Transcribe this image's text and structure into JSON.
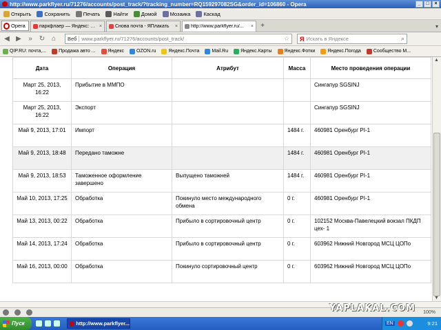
{
  "window": {
    "title": "http://www.parkflyer.ru/71276/accounts/post_track/?tracking_number=RQ159297082SG&order_id=106860 - Opera",
    "buttons": [
      "_",
      "□",
      "×"
    ]
  },
  "toolbar": {
    "items": [
      {
        "label": "Открыть",
        "icon": "folder-icon",
        "color": "#d9a630"
      },
      {
        "label": "Сохранить",
        "icon": "save-icon",
        "color": "#3a6fc4"
      },
      {
        "label": "Печать",
        "icon": "print-icon",
        "color": "#777777"
      },
      {
        "label": "Найти",
        "icon": "find-icon",
        "color": "#5a5a5a"
      },
      {
        "label": "Домой",
        "icon": "home-icon",
        "color": "#4b8b3b"
      },
      {
        "label": "Мозаика",
        "icon": "tile-icon",
        "color": "#6f6f9c"
      },
      {
        "label": "Каскад",
        "icon": "cascade-icon",
        "color": "#6f6f9c"
      }
    ]
  },
  "tabs": {
    "opera_label": "Opera",
    "items": [
      {
        "label": "паркфлаер — Яндекс: наш...",
        "active": false
      },
      {
        "label": "Снова почта - ЯПлакать",
        "active": false
      },
      {
        "label": "http://www.parkflyer.ru/...",
        "active": true
      }
    ],
    "new_tab": "+",
    "tab_list": "▾"
  },
  "address": {
    "web_label": "Веб",
    "url": "www.parkflyer.ru/71276/accounts/post_track/",
    "search_placeholder": "Искать в Яндексе",
    "search_logo": "Я"
  },
  "bookmarks": [
    {
      "label": "QIP.RU: почта,...",
      "color": "#6ab04c"
    },
    {
      "label": "Продажа авто ...",
      "color": "#c0392b"
    },
    {
      "label": "Яндекс",
      "color": "#e74c3c"
    },
    {
      "label": "OZON.ru",
      "color": "#2e86de"
    },
    {
      "label": "Яндекс.Почта",
      "color": "#f1c40f"
    },
    {
      "label": "Mail.Ru",
      "color": "#2e86de"
    },
    {
      "label": "Яндекс.Карты",
      "color": "#27ae60"
    },
    {
      "label": "Яндекс.Фотки",
      "color": "#e67e22"
    },
    {
      "label": "Яндекс.Погода",
      "color": "#f39c12"
    },
    {
      "label": "Сообщество М...",
      "color": "#c0392b"
    }
  ],
  "table": {
    "headers": {
      "date": "Дата",
      "operation": "Операция",
      "attribute": "Атрибут",
      "mass": "Масса",
      "place": "Место проведения операции"
    },
    "rows": [
      {
        "date": "Март 25, 2013, 16:22",
        "operation": "Прибытие в ММПО",
        "attribute": "",
        "mass": "",
        "place": "Сингапур SGSINJ"
      },
      {
        "date": "Март 25, 2013, 16:22",
        "operation": "Экспорт",
        "attribute": "",
        "mass": "",
        "place": "Сингапур SGSINJ"
      },
      {
        "date": "Май 9, 2013, 17:01",
        "operation": "Импорт",
        "attribute": "",
        "mass": "1484 г.",
        "place": "460981 Оренбург PI-1"
      },
      {
        "date": "Май 9, 2013, 18:48",
        "operation": "Передано таможне",
        "attribute": "",
        "mass": "1484 г.",
        "place": "460981 Оренбург PI-1"
      },
      {
        "date": "Май 9, 2013, 18:53",
        "operation": "Таможенное оформление завершено",
        "attribute": "Выпущено таможней",
        "mass": "1484 г.",
        "place": "460981 Оренбург PI-1"
      },
      {
        "date": "Май 10, 2013, 17:25",
        "operation": "Обработка",
        "attribute": "Покинуло место международного обмена",
        "mass": "0 г.",
        "place": "460981 Оренбург PI-1"
      },
      {
        "date": "Май 13, 2013, 00:22",
        "operation": "Обработка",
        "attribute": "Прибыло в сортировочный центр",
        "mass": "0 г.",
        "place": "102152 Москва-Павелецкий вокзал ПКДП цех- 1"
      },
      {
        "date": "Май 14, 2013, 17:24",
        "operation": "Обработка",
        "attribute": "Прибыло в сортировочный центр",
        "mass": "0 г.",
        "place": "603962 Нижний Новгород МСЦ ЦОПо"
      },
      {
        "date": "Май 16, 2013, 00:00",
        "operation": "Обработка",
        "attribute": "Покинуло сортировочный центр",
        "mass": "0 г.",
        "place": "603962 Нижний Новгород МСЦ ЦОПо"
      }
    ]
  },
  "status": {
    "zoom": "100%",
    "watermark": "YAPLAKAL.COM"
  },
  "taskbar": {
    "start_label": "Пуск",
    "task_label": "http://www.parkflyer...",
    "lang": "EN",
    "clock": "9:21"
  }
}
